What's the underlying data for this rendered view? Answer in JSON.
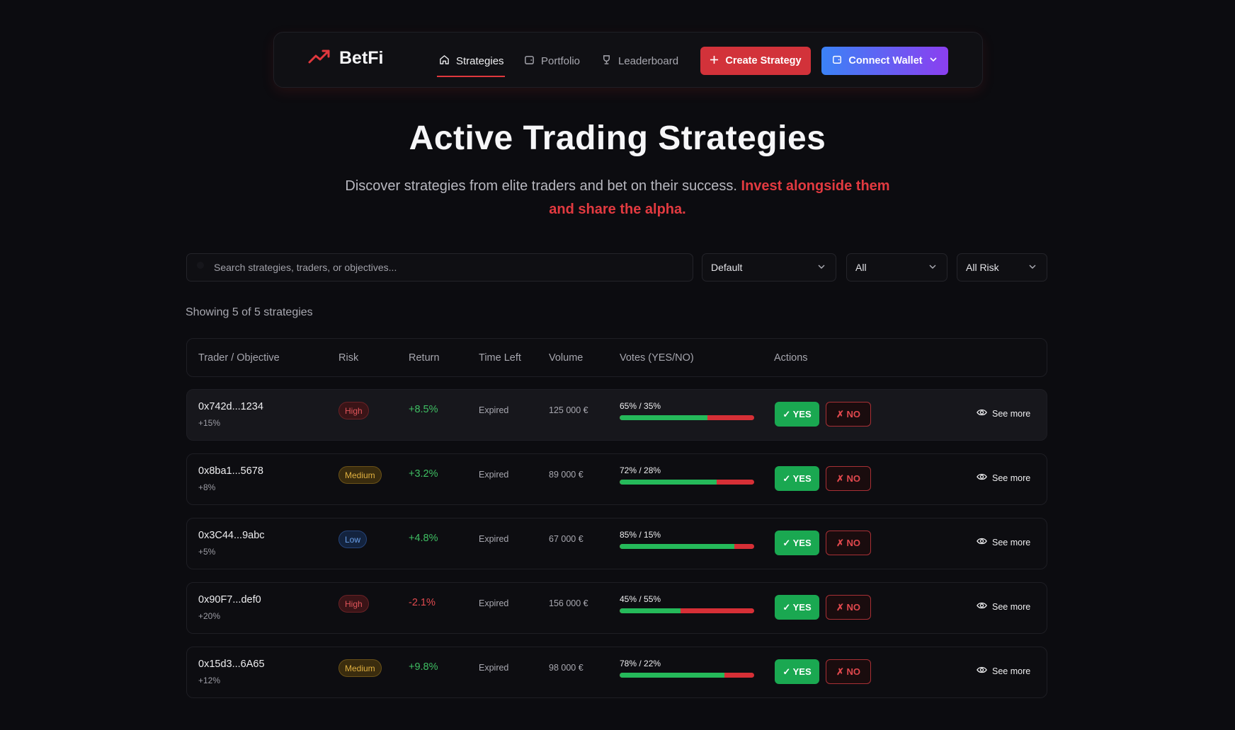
{
  "nav": {
    "brand": "BetFi",
    "items": [
      {
        "label": "Strategies",
        "icon": "home-icon",
        "active": true
      },
      {
        "label": "Portfolio",
        "icon": "wallet-icon",
        "active": false
      },
      {
        "label": "Leaderboard",
        "icon": "trophy-icon",
        "active": false
      }
    ],
    "create_label": "Create Strategy",
    "wallet_label": "Connect Wallet"
  },
  "hero": {
    "title": "Active Trading Strategies",
    "subtitle": "Discover strategies from elite traders and bet on their success.",
    "subtitle_accent": "Invest alongside them and share the alpha."
  },
  "filters": {
    "search_placeholder": "Search strategies, traders, or objectives...",
    "sort": "Default",
    "status": "All",
    "risk": "All Risk"
  },
  "showing": "Showing 5 of 5 strategies",
  "table": {
    "headers": [
      "Trader / Objective",
      "Risk",
      "Return",
      "Time Left",
      "Volume",
      "Votes (YES/NO)",
      "Actions"
    ],
    "rows": [
      {
        "trader": "0x742d...1234",
        "objective": "+15%",
        "risk": "High",
        "return": "+8.5%",
        "time_left": "Expired",
        "volume": "125 000 €",
        "votes": "65% / 35%",
        "yes_pct": 65,
        "yes": "✓ YES",
        "no": "✗ NO",
        "see_more": "See more"
      },
      {
        "trader": "0x8ba1...5678",
        "objective": "+8%",
        "risk": "Medium",
        "return": "+3.2%",
        "time_left": "Expired",
        "volume": "89 000 €",
        "votes": "72% / 28%",
        "yes_pct": 72,
        "yes": "✓ YES",
        "no": "✗ NO",
        "see_more": "See more"
      },
      {
        "trader": "0x3C44...9abc",
        "objective": "+5%",
        "risk": "Low",
        "return": "+4.8%",
        "time_left": "Expired",
        "volume": "67 000 €",
        "votes": "85% / 15%",
        "yes_pct": 85,
        "yes": "✓ YES",
        "no": "✗ NO",
        "see_more": "See more"
      },
      {
        "trader": "0x90F7...def0",
        "objective": "+20%",
        "risk": "High",
        "return": "-2.1%",
        "time_left": "Expired",
        "volume": "156 000 €",
        "votes": "45% / 55%",
        "yes_pct": 45,
        "yes": "✓ YES",
        "no": "✗ NO",
        "see_more": "See more"
      },
      {
        "trader": "0x15d3...6A65",
        "objective": "+12%",
        "risk": "Medium",
        "return": "+9.8%",
        "time_left": "Expired",
        "volume": "98 000 €",
        "votes": "78% / 22%",
        "yes_pct": 78,
        "yes": "✓ YES",
        "no": "✗ NO",
        "see_more": "See more"
      }
    ]
  },
  "colors": {
    "accent": "#d2323a",
    "yes": "#1aa851",
    "no": "#d62f36",
    "background": "#0c0c10"
  }
}
